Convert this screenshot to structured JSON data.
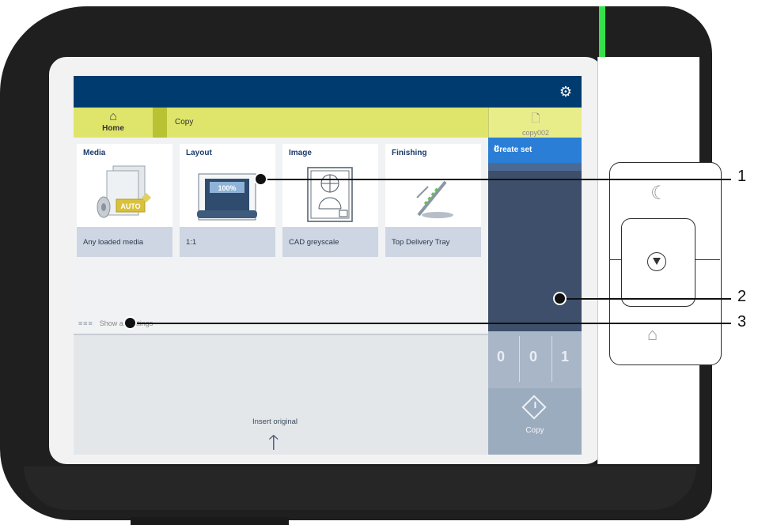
{
  "screen": {
    "header": {
      "settings_icon": "gear-icon"
    },
    "tabs": {
      "home_label": "Home",
      "home_icon": "home-icon",
      "copy_label": "Copy",
      "job_label": "copy002",
      "job_icon": "document-icon"
    },
    "tiles": [
      {
        "title": "Media",
        "value": "Any loaded media",
        "badge": "AUTO",
        "icon": "media-icon"
      },
      {
        "title": "Layout",
        "value": "1:1",
        "badge": "100%",
        "icon": "layout-icon"
      },
      {
        "title": "Image",
        "value": "CAD greyscale",
        "icon": "image-icon"
      },
      {
        "title": "Finishing",
        "value": "Top Delivery Tray",
        "icon": "finishing-icon"
      }
    ],
    "show_all": "Show all settings",
    "insert_original": "Insert original",
    "right_panel": {
      "create_set_label": "Create set",
      "counter": [
        "0",
        "0",
        "1"
      ],
      "copy_button_label": "Copy",
      "copy_icon": "start-icon"
    }
  },
  "hardware": {
    "sleep_icon": "moon-icon",
    "stop_icon": "stop-icon",
    "home_icon": "home-icon",
    "led_color": "#35e04a"
  },
  "callouts": [
    "1",
    "2",
    "3"
  ],
  "colors": {
    "header": "#003b70",
    "tab_bar": "#dfe56a",
    "accent": "#2a7ed6",
    "panel": "#3d4f6a"
  }
}
